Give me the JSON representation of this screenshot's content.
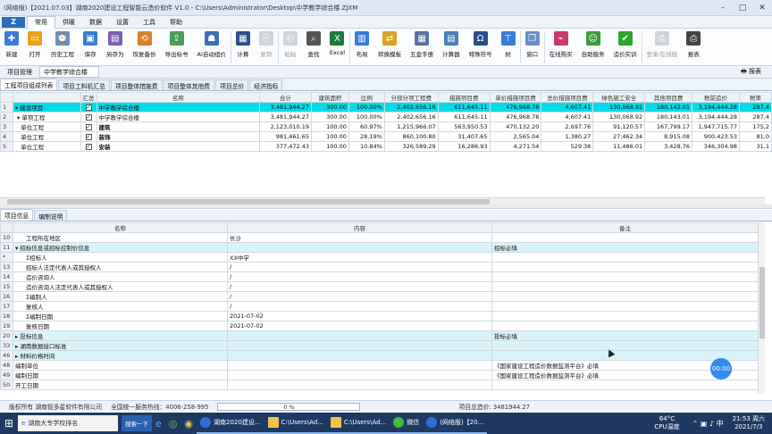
{
  "title": "(网络版)【2021.07.03】湖南2020建设工程智能云造价软件 V1.0 - C:\\Users\\Administrator\\Desktop\\中学教学综合楼.ZJXM",
  "menu": [
    "常用",
    "供暖",
    "数据",
    "设置",
    "工具",
    "帮助"
  ],
  "toolbar": [
    "新建",
    "打开",
    "历史工程",
    "保存",
    "另存为",
    "恢复备份",
    "导出标书",
    "AI自动组价",
    "计算",
    "复制",
    "粘贴",
    "查找",
    "Excel",
    "布局",
    "转换模板",
    "五金手册",
    "计算器",
    "特殊符号",
    "树",
    "窗口",
    "在线购买",
    "自助服务",
    "造价实训",
    "登录/在线版",
    "报表"
  ],
  "toolbar_disabled": [
    "复制",
    "粘贴",
    "登录/在线版"
  ],
  "project": {
    "label": "项目管理",
    "tab": "中学教学综合楼",
    "report": "报表"
  },
  "subtabs": [
    "工程项目组成列表",
    "项目工料机汇总",
    "项目整体措施费",
    "项目整体其他费",
    "项目总价",
    "经济指标"
  ],
  "top_headers": [
    "汇总",
    "名称",
    "合计",
    "建筑面积",
    "比例",
    "分部分项工程费",
    "措施项目费",
    "单价措施项目费",
    "总价措施项目费",
    "绿色施工安全",
    "其他项目费",
    "税前造价",
    "税率"
  ],
  "top_rows": [
    {
      "rn": "1",
      "name": "建设项目",
      "total": "3,481,944.27",
      "area": "300.00",
      "ratio": "100.00%",
      "fb": "2,402,656.16",
      "cs": "611,645.11",
      "djcs": "476,968.78",
      "zjcs": "4,607.41",
      "lssg": "130,068.92",
      "qt": "180,143.01",
      "sq": "3,194,444.28",
      "sl": "287,4"
    },
    {
      "rn": "2",
      "name": "单项工程",
      "tree": "中学教学综合楼",
      "total": "3,481,944.27",
      "area": "300.00",
      "ratio": "100.00%",
      "fb": "2,402,656.16",
      "cs": "611,645.11",
      "djcs": "476,968.78",
      "zjcs": "4,607.41",
      "lssg": "130,068.92",
      "qt": "180,143.01",
      "sq": "3,194,444.28",
      "sl": "287,4"
    },
    {
      "rn": "3",
      "name": "单位工程",
      "tree": "建筑",
      "total": "2,123,010.19",
      "area": "100.00",
      "ratio": "60.97%",
      "fb": "1,215,966.07",
      "cs": "563,950.53",
      "djcs": "470,132.20",
      "zjcs": "2,697.76",
      "lssg": "91,120.57",
      "qt": "167,799.17",
      "sq": "1,947,715.77",
      "sl": "175,2"
    },
    {
      "rn": "4",
      "name": "单位工程",
      "tree": "装饰",
      "total": "981,461.65",
      "area": "100.00",
      "ratio": "28.19%",
      "fb": "860,100.80",
      "cs": "31,407.65",
      "djcs": "2,565.04",
      "zjcs": "1,380.27",
      "lssg": "27,462.34",
      "qt": "8,915.08",
      "sq": "900,423.53",
      "sl": "81,0"
    },
    {
      "rn": "5",
      "name": "单位工程",
      "tree": "安装",
      "total": "377,472.43",
      "area": "100.00",
      "ratio": "10.84%",
      "fb": "326,589.29",
      "cs": "16,286.93",
      "djcs": "4,271.54",
      "zjcs": "529.38",
      "lssg": "11,486.01",
      "qt": "3,428.76",
      "sq": "346,304.98",
      "sl": "31,1"
    }
  ],
  "bottom_tabs": [
    "项目信息",
    "编制说明"
  ],
  "bottom_headers": [
    "名称",
    "内容",
    "备注"
  ],
  "bottom_rows": [
    {
      "rn": "10",
      "name": "工程所在地区",
      "content": "长沙",
      "note": "",
      "indent": 2
    },
    {
      "rn": "11",
      "name": "招标信息或招标控制价信息",
      "content": "",
      "note": "招标必填",
      "cyan": true,
      "exp": "-",
      "indent": 0
    },
    {
      "rn": "*",
      "name": "Σ招标人",
      "content": "XX中学",
      "note": "",
      "indent": 2
    },
    {
      "rn": "13",
      "name": "招标人法定代表人或其授权人",
      "content": "/",
      "note": "",
      "indent": 2
    },
    {
      "rn": "14",
      "name": "造价咨询人",
      "content": "/",
      "note": "",
      "indent": 2
    },
    {
      "rn": "15",
      "name": "造价咨询人法定代表人或其授权人",
      "content": "/",
      "note": "",
      "indent": 2
    },
    {
      "rn": "16",
      "name": "Σ编制人",
      "content": "/",
      "note": "",
      "indent": 2
    },
    {
      "rn": "17",
      "name": "复核人",
      "content": "/",
      "note": "",
      "indent": 2
    },
    {
      "rn": "18",
      "name": "Σ编制日期",
      "content": "2021-07-02",
      "note": "",
      "indent": 2
    },
    {
      "rn": "19",
      "name": "复核日期",
      "content": "2021-07-02",
      "note": "",
      "indent": 2
    },
    {
      "rn": "20",
      "name": "投标信息",
      "content": "",
      "note": "投标必填",
      "cyan": true,
      "exp": "+",
      "indent": 0
    },
    {
      "rn": "33",
      "name": "湖南数据接口标准",
      "content": "",
      "note": "",
      "cyan": true,
      "exp": "+",
      "indent": 0
    },
    {
      "rn": "46",
      "name": "材料价格时间",
      "content": "",
      "note": "",
      "cyan": true,
      "exp": "+",
      "indent": 0
    },
    {
      "rn": "48",
      "name": "编制单位",
      "content": "",
      "note": "《国家建设工程造价数据监测平台》必填",
      "indent": 0
    },
    {
      "rn": "49",
      "name": "编制日期",
      "content": "",
      "note": "《国家建设工程造价数据监测平台》必填",
      "indent": 0
    },
    {
      "rn": "50",
      "name": "开工日期",
      "content": "",
      "note": "",
      "indent": 0
    }
  ],
  "status": {
    "copyright": "版权所有 湖南智多星软件有限公司",
    "hotline": "全国统一服务热线：4006-258-995",
    "progress": "0 %",
    "progress_value": 0,
    "total": "项目总造价: 3481944.27"
  },
  "float_btn": "00:00",
  "taskbar": {
    "search_placeholder": "湖南大专学校排名",
    "search_btn": "搜索一下",
    "items": [
      "湖南2020建设...",
      "C:\\Users\\Ad...",
      "C:\\Users\\Ad...",
      "微信",
      "(网络版)【20..."
    ],
    "temp": "64°C",
    "temp_label": "CPU温度",
    "time": "21:53 周六",
    "date": "2021/7/3"
  }
}
